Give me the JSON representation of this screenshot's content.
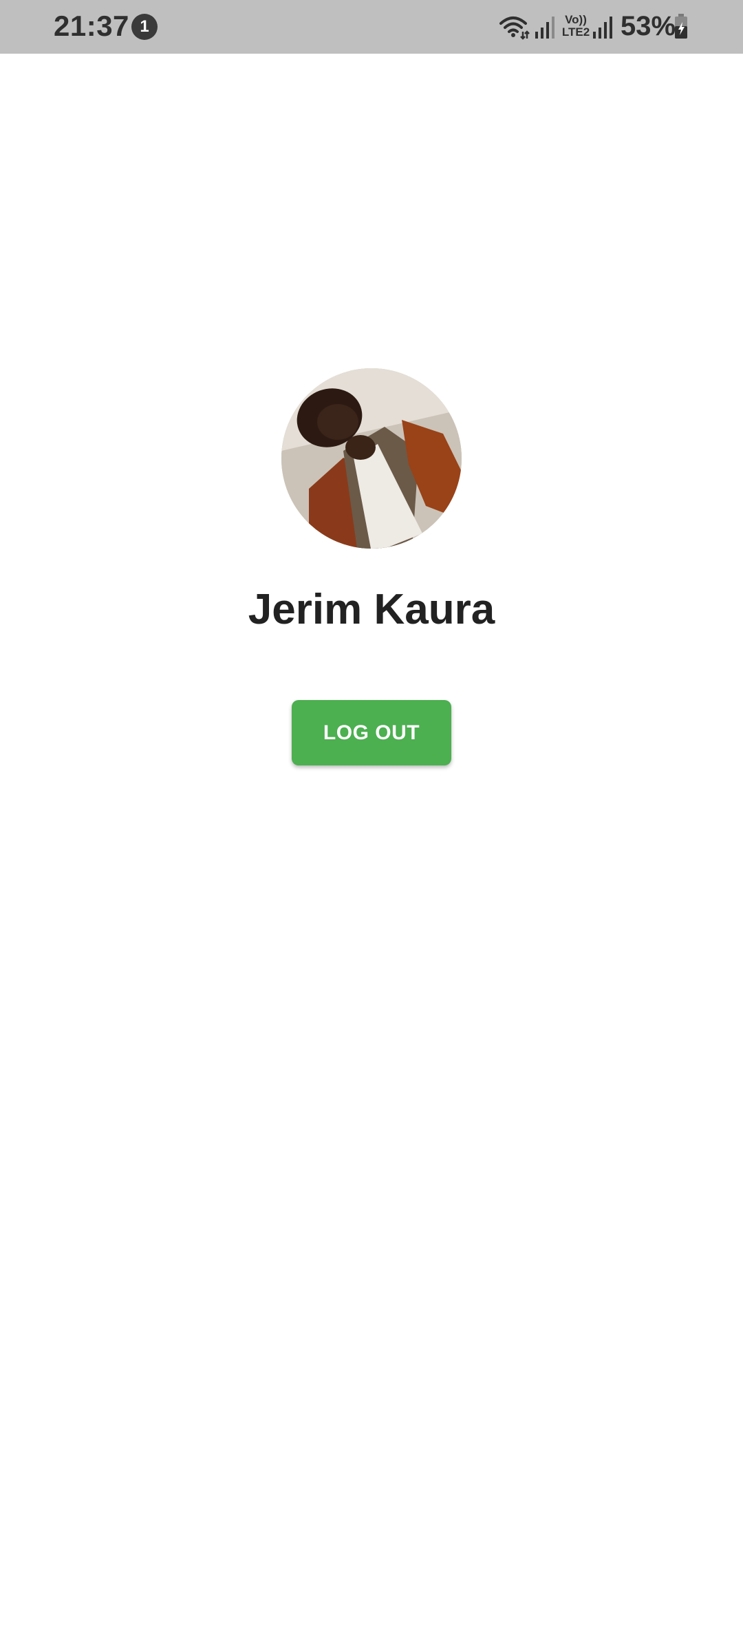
{
  "status_bar": {
    "time": "21:37",
    "notification_count": "1",
    "network_label_top": "Vo))",
    "network_label_bottom": "LTE2",
    "battery_percent": "53%",
    "background_color": "#bfbfbf"
  },
  "profile": {
    "name": "Jerim Kaura",
    "avatar_icon": "profile-photo"
  },
  "actions": {
    "logout_label": "LOG OUT",
    "logout_color": "#4caf50"
  }
}
